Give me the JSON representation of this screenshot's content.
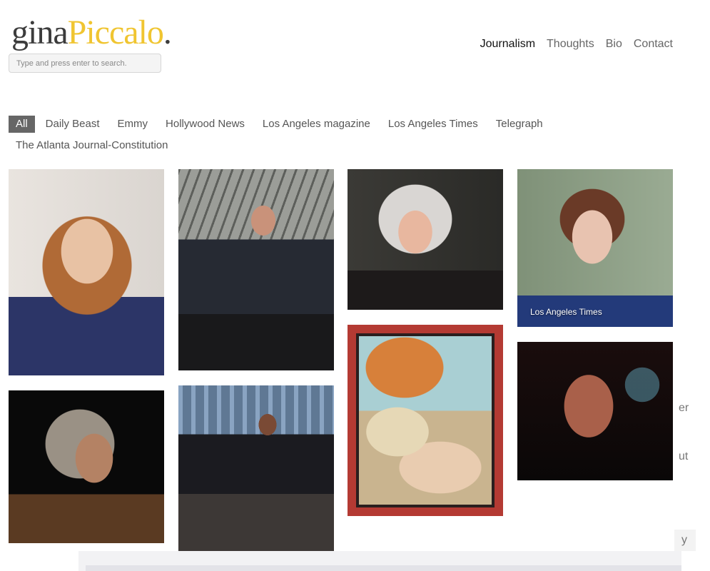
{
  "logo": {
    "part1": "gina",
    "part2": "Piccalo",
    "dot": "."
  },
  "search": {
    "placeholder": "Type and press enter to search."
  },
  "nav": {
    "items": [
      {
        "label": "Journalism",
        "active": true
      },
      {
        "label": "Thoughts"
      },
      {
        "label": "Bio"
      },
      {
        "label": "Contact"
      }
    ]
  },
  "filters": {
    "items": [
      {
        "label": "All",
        "active": true
      },
      {
        "label": "Daily Beast"
      },
      {
        "label": "Emmy"
      },
      {
        "label": "Hollywood News"
      },
      {
        "label": "Los Angeles magazine"
      },
      {
        "label": "Los Angeles Times"
      },
      {
        "label": "Telegraph"
      },
      {
        "label": "The Atlanta Journal-Constitution"
      }
    ]
  },
  "grid": {
    "hover_caption": "Los Angeles Times"
  },
  "edge_text": {
    "a": "er",
    "b": "ut",
    "c": "y"
  },
  "colors": {
    "logo_dark": "#3c3c3c",
    "logo_accent": "#f0c531",
    "active_filter_bg": "#666666"
  }
}
